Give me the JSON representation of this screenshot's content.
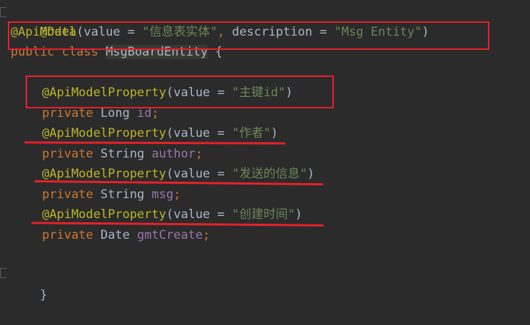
{
  "code": {
    "line1": {
      "annotation": "@Data"
    },
    "line2": {
      "annotation": "@ApiModel",
      "open": "(",
      "p1": "value",
      "eq1": " = ",
      "s1": "\"信息表实体\"",
      "comma": ", ",
      "p2": "description",
      "eq2": " = ",
      "s2": "\"Msg Entity\"",
      "close": ")"
    },
    "line3": {
      "kw1": "public",
      "kw2": "class",
      "classname": "MsgBoardEntity",
      "brace": " {"
    },
    "props": [
      {
        "annotation": "@ApiModelProperty",
        "open": "(value = ",
        "str": "\"主键id\"",
        "close": ")",
        "kw": "private",
        "type": " Long ",
        "field": "id",
        "semi": ";"
      },
      {
        "annotation": "@ApiModelProperty",
        "open": "(value = ",
        "str": "\"作者\"",
        "close": ")",
        "kw": "private",
        "type": " String ",
        "field": "author",
        "semi": ";"
      },
      {
        "annotation": "@ApiModelProperty",
        "open": "(value = ",
        "str": "\"发送的信息\"",
        "close": ")",
        "kw": "private",
        "type": " String ",
        "field": "msg",
        "semi": ";"
      },
      {
        "annotation": "@ApiModelProperty",
        "open": "(value = ",
        "str": "\"创建时间\"",
        "close": ")",
        "kw": "private",
        "type": " Date ",
        "field": "gmtCreate",
        "semi": ";"
      }
    ],
    "closing": "}"
  },
  "colors": {
    "background": "#2b2b2b",
    "annotation": "#bbb529",
    "keyword": "#cc7832",
    "string": "#6a8759",
    "field": "#9876aa",
    "highlight": "#e8202b"
  }
}
